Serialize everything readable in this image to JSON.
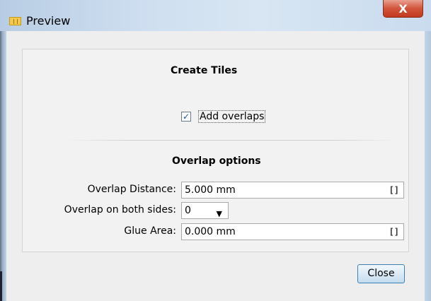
{
  "window": {
    "title": "Preview",
    "close_glyph": "X",
    "app_icon": "tile-icon",
    "close_icon": "close-icon"
  },
  "create_tiles": {
    "title": "Create Tiles",
    "add_overlaps": {
      "label": "Add overlaps",
      "checked": true,
      "check_glyph": "✓"
    }
  },
  "overlap_options": {
    "title": "Overlap options",
    "overlap_distance": {
      "label": "Overlap Distance:",
      "value": "5.000 mm",
      "bracket": "[]"
    },
    "overlap_both_sides": {
      "label": "Overlap on both sides:",
      "value": "0",
      "arrow": "▼"
    },
    "glue_area": {
      "label": "Glue Area:",
      "value": "0.000 mm",
      "bracket": "[]"
    }
  },
  "buttons": {
    "close": "Close"
  },
  "colors": {
    "titlebar": "#cfdff0",
    "close_x": "#c23a1f",
    "accent": "#3c7fb1"
  }
}
